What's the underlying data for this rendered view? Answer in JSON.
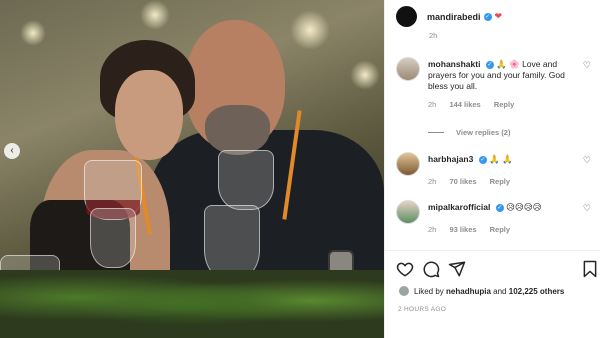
{
  "post": {
    "author": "mandirabedi",
    "author_emoji": "❤",
    "time": "2h"
  },
  "comments": [
    {
      "username": "mohanshakti",
      "text": "🙏 🌸 Love and prayers for you and your family. God bless you all.",
      "time": "2h",
      "likes": "144 likes",
      "reply_label": "Reply",
      "verified": true
    },
    {
      "username": "harbhajan3",
      "text": "🙏 🙏",
      "time": "2h",
      "likes": "70 likes",
      "reply_label": "Reply",
      "verified": true
    },
    {
      "username": "mipalkarofficial",
      "text": "😥😥😥😥",
      "time": "2h",
      "likes": "93 likes",
      "reply_label": "Reply",
      "verified": true
    }
  ],
  "view_replies": "View replies (2)",
  "liked_by": {
    "prefix": "Liked by",
    "user": "nehadhupia",
    "conj": "and",
    "count": "102,225 others"
  },
  "time_ago": "2 HOURS AGO",
  "icons": {
    "prev": "chevron-left-icon",
    "like": "heart-icon",
    "comment": "comment-icon",
    "share": "send-icon",
    "save": "bookmark-icon"
  }
}
